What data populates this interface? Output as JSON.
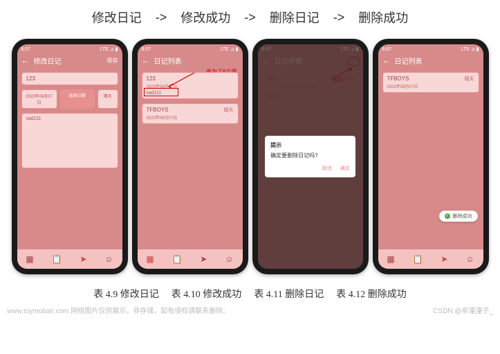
{
  "flow": {
    "s1": "修改日记",
    "a1": "->",
    "s2": "修改成功",
    "a2": "->",
    "s3": "删除日记",
    "a3": "->",
    "s4": "删除成功"
  },
  "status": {
    "time": "8:07",
    "right": "LTE ⊿ ▮"
  },
  "p1": {
    "back": "←",
    "title": "修改日记",
    "save": "保存",
    "titleField": "123",
    "date": "2023年06月07日",
    "dateBtn": "选择日期",
    "weather": "晴天",
    "body": "sad111"
  },
  "p2": {
    "back": "←",
    "title": "日记列表",
    "note": "变为了6个字",
    "c1": {
      "title": "123",
      "date": "2023年06月07日",
      "body": "sad111",
      "weather": ""
    },
    "c2": {
      "title": "TFBOYS",
      "date": "2023年06月07日",
      "body": "",
      "weather": "晴天"
    }
  },
  "p3": {
    "back": "←",
    "title": "日记详情",
    "del": "删除",
    "c": {
      "title": "123",
      "date": "2023年06月07日  Thursday",
      "body": "sad111",
      "weather": "晴天"
    },
    "dlg": {
      "title": "提示",
      "msg": "确定要删除日记吗?",
      "cancel": "取消",
      "ok": "确定"
    }
  },
  "p4": {
    "back": "←",
    "title": "日记列表",
    "c": {
      "title": "TFBOYS",
      "date": "2023年06月07日",
      "body": "",
      "weather": "晴天"
    },
    "toast": "删除成功"
  },
  "nav": {
    "i1": "▦",
    "i2": "📋",
    "i3": "➤",
    "i4": "☺"
  },
  "cap": {
    "c1": "表 4.9 修改日记",
    "c2": "表 4.10 修改成功",
    "c3": "表 4.11 删除日记",
    "c4": "表 4.12 删除成功"
  },
  "foot": {
    "left": "www.toymoban.com 网络图片仅供展示，非存储，如有侵权请联系删除。",
    "right": "CSDN @牟潼潼子_"
  }
}
